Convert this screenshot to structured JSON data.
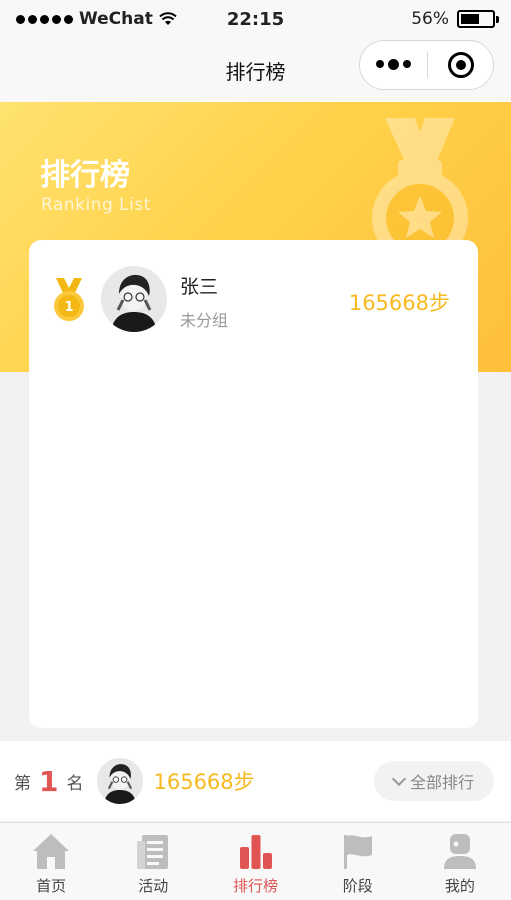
{
  "status_bar": {
    "carrier": "WeChat",
    "time": "22:15",
    "battery": "56%",
    "battery_level": 0.56
  },
  "nav": {
    "title": "排行榜"
  },
  "banner": {
    "title": "排行榜",
    "subtitle": "Ranking List"
  },
  "ranking": [
    {
      "rank": "1",
      "name": "张三",
      "group": "未分组",
      "steps": "165668步"
    }
  ],
  "my_rank": {
    "prefix": "第",
    "rank": "1",
    "suffix": "名",
    "steps": "165668步",
    "all_label": "全部排行"
  },
  "tabbar": {
    "items": [
      {
        "label": "首页",
        "icon": "home-icon"
      },
      {
        "label": "活动",
        "icon": "activity-icon"
      },
      {
        "label": "排行榜",
        "icon": "ranking-icon",
        "active": true
      },
      {
        "label": "阶段",
        "icon": "flag-icon"
      },
      {
        "label": "我的",
        "icon": "profile-icon"
      }
    ]
  },
  "colors": {
    "accent_gold": "#f7b91e",
    "accent_red": "#e05454",
    "banner_start": "#ffe270",
    "banner_end": "#ffbf3a"
  }
}
